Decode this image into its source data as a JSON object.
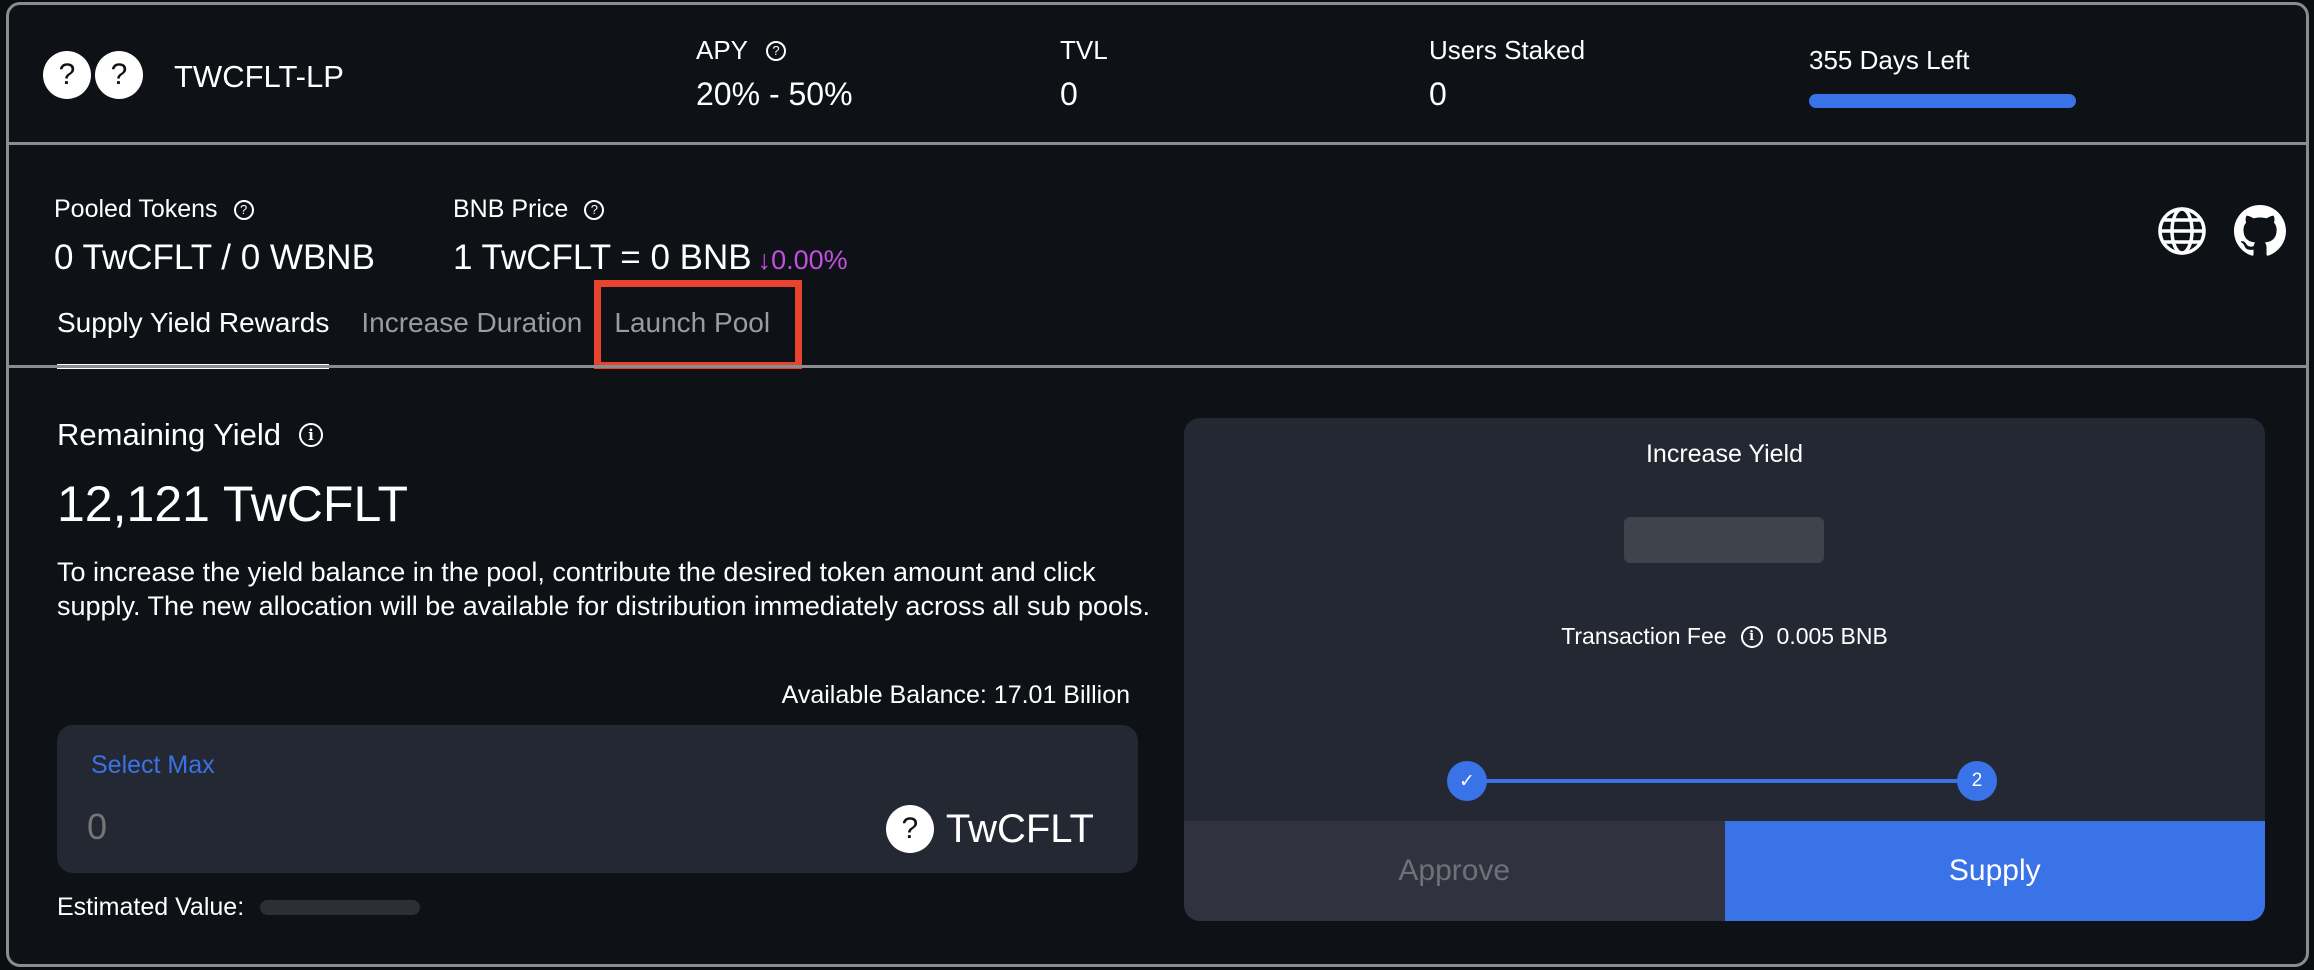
{
  "header": {
    "pool_name": "TWCFLT-LP",
    "token_icons": [
      "question-icon",
      "question-icon"
    ],
    "token_icon_glyph": "?",
    "stats": [
      {
        "label": "APY",
        "value": "20% - 50%",
        "has_help": true
      },
      {
        "label": "TVL",
        "value": "0",
        "has_help": false
      },
      {
        "label": "Users Staked",
        "value": "0",
        "has_help": false
      }
    ],
    "days_left_label": "355 Days Left",
    "days_left_progress_percent": 100,
    "help_glyph": "?"
  },
  "pool_info": {
    "pooled_tokens_label": "Pooled Tokens",
    "pooled_tokens_value": "0 TwCFLT / 0 WBNB",
    "price_label": "BNB Price",
    "price_value": "1 TwCFLT = 0 BNB",
    "price_change": "↓0.00%",
    "price_change_color": "#c34fe0"
  },
  "links": {
    "website_icon": "globe-icon",
    "github_icon": "github-icon"
  },
  "tabs": [
    {
      "label": "Supply Yield Rewards",
      "active": true
    },
    {
      "label": "Increase Duration",
      "active": false
    },
    {
      "label": "Launch Pool",
      "active": false,
      "highlighted": true
    }
  ],
  "supply": {
    "remaining_title": "Remaining Yield",
    "remaining_value": "12,121 TwCFLT",
    "info_glyph": "i",
    "description": "To increase the yield balance in the pool, contribute the desired token amount and click supply. The new allocation will be available for distribution immediately across all sub pools.",
    "available_balance": "Available Balance: 17.01 Billion",
    "select_max_label": "Select Max",
    "amount_value": "",
    "amount_placeholder": "0",
    "token_symbol": "TwCFLT",
    "estimated_value_label": "Estimated Value:"
  },
  "card": {
    "title": "Increase Yield",
    "fee_label": "Transaction Fee",
    "fee_value": "0.005 BNB",
    "steps": [
      {
        "state": "done",
        "glyph": "✓"
      },
      {
        "state": "current",
        "glyph": "2"
      }
    ],
    "approve_label": "Approve",
    "supply_label": "Supply"
  },
  "colors": {
    "accent": "#3a72e8",
    "background": "#0e1116",
    "card": "#242833",
    "highlight": "#e8432c"
  }
}
